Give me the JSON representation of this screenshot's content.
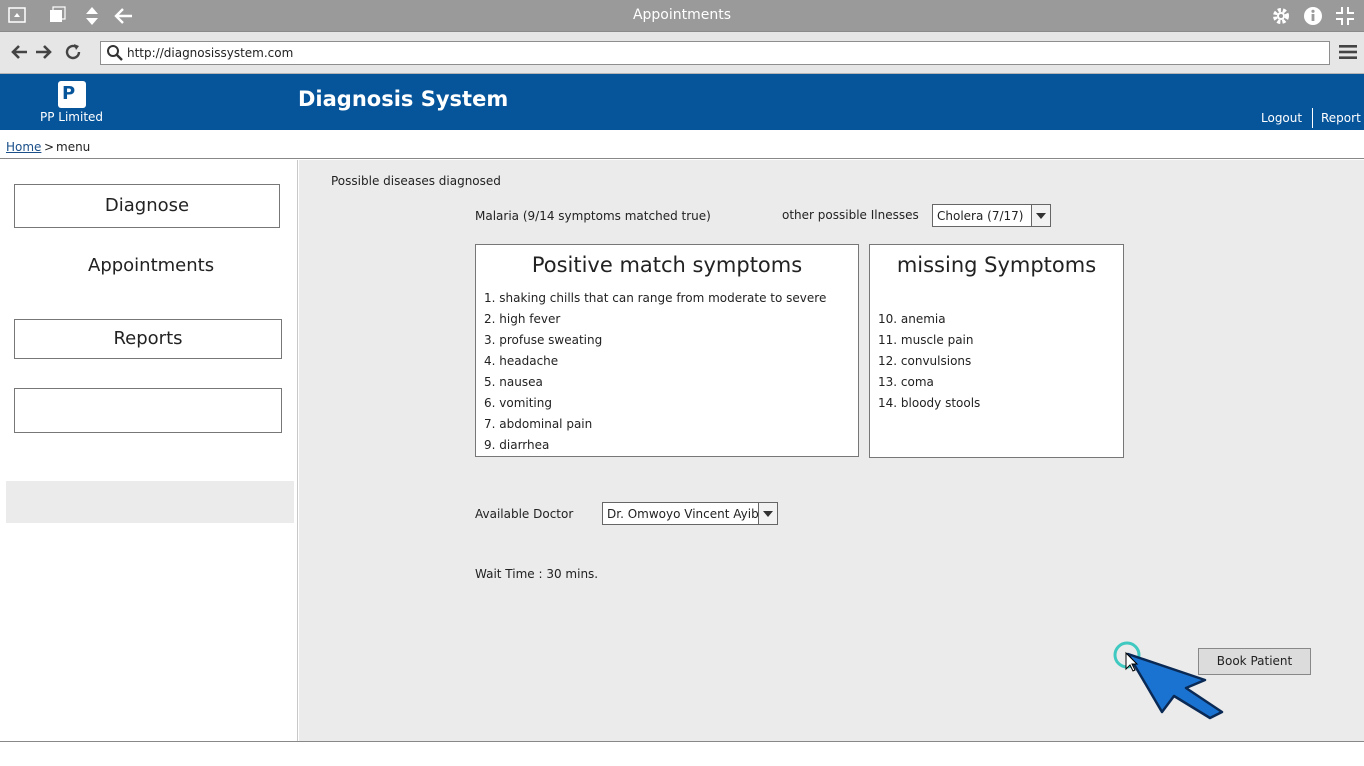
{
  "window": {
    "title": "Appointments"
  },
  "browser": {
    "url": "http://diagnosissystem.com"
  },
  "header": {
    "logo_text": "PP Limited",
    "logo_mark": "P",
    "app_title": "Diagnosis System",
    "links": {
      "logout": "Logout",
      "report": "Report"
    }
  },
  "breadcrumb": {
    "home": "Home",
    "separator": ">",
    "current": "menu"
  },
  "sidebar": {
    "diagnose": "Diagnose",
    "appointments": "Appointments",
    "reports": "Reports"
  },
  "main": {
    "heading": "Possible diseases diagnosed",
    "primary_diagnosis": "Malaria (9/14 symptoms matched true)",
    "other_label": "other possible Ilnesses",
    "other_selected": "Cholera (7/17)",
    "positive": {
      "title": "Positive match symptoms",
      "items": [
        "1. shaking chills that can range from moderate to severe",
        "2. high fever",
        "3. profuse sweating",
        "4. headache",
        "5. nausea",
        "6. vomiting",
        "7. abdominal pain",
        "9. diarrhea"
      ]
    },
    "missing": {
      "title": "missing Symptoms",
      "items": [
        "10. anemia",
        "11. muscle pain",
        "12. convulsions",
        "13. coma",
        "14. bloody stools"
      ]
    },
    "doctor_label": "Available Doctor",
    "doctor_selected": "Dr. Omwoyo Vincent Ayib",
    "wait_time": "Wait Time : 30 mins.",
    "book_button": "Book Patient"
  },
  "colors": {
    "header_bg": "#06549a",
    "content_bg": "#ebebeb",
    "cursor": "#1a73d0"
  }
}
